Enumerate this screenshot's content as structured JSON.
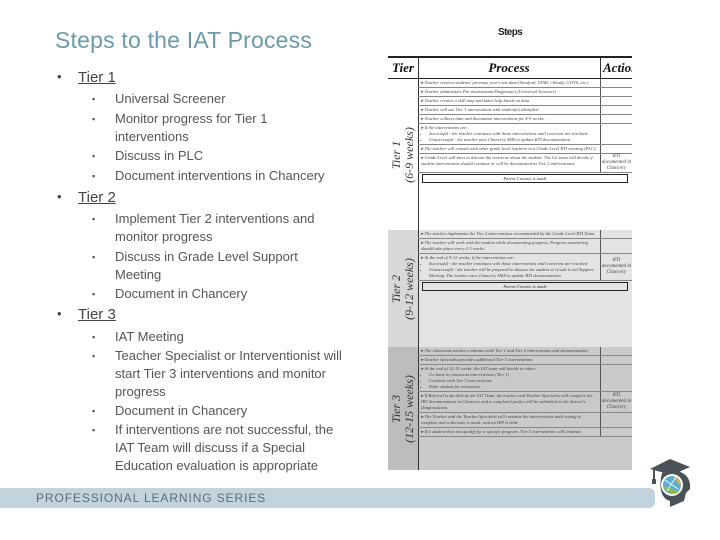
{
  "slide": {
    "title": "Steps to the IAT Process",
    "outline": [
      {
        "label": "Tier 1",
        "items": [
          "Universal Screener",
          "Monitor progress for Tier 1 interventions",
          "Discuss in PLC",
          "Document interventions in Chancery"
        ]
      },
      {
        "label": "Tier 2",
        "items": [
          "Implement Tier 2 interventions and monitor progress",
          "Discuss in Grade Level Support Meeting",
          "Document in Chancery"
        ]
      },
      {
        "label": "Tier 3",
        "items": [
          "IAT Meeting",
          "Teacher Specialist or Interventionist will start Tier 3 interventions and monitor progress",
          "Document in Chancery",
          "If interventions are not successful, the IAT Team will discuss if a Special Education evaluation is appropriate"
        ]
      }
    ],
    "footer": "PROFESSIONAL LEARNING SERIES",
    "logo_icon": "graduation-cap-head-globe-icon"
  },
  "document": {
    "title": "Steps",
    "headers": {
      "tier": "Tier",
      "process": "Process",
      "action": "Action"
    },
    "tiers": [
      {
        "label": "Tier 1",
        "duration": "(6-9 weeks)",
        "rows": [
          {
            "process": "Teacher reviews students' previous year's test data (Stanford, STAR, i-Ready, GOVS, etc.)",
            "action": ""
          },
          {
            "process": "Teacher administers Pre-assessments/Diagnostics (Universal Screener)",
            "action": ""
          },
          {
            "process": "Teacher creates a skill map and takes help based on data",
            "action": ""
          },
          {
            "process": "Teacher will use Tier 1 interventions with student(s) identified",
            "action": ""
          },
          {
            "process": "Teacher collects data and documents interventions for 4-9 weeks.",
            "action": ""
          },
          {
            "process": "If the interventions are:",
            "sub": [
              "Successful - the teacher continues with those interventions until concerns are resolved",
              "Unsuccessful - the teacher uses Chancery SMS to update RTI documentation"
            ],
            "action": ""
          },
          {
            "process": "The teacher will consult with other grade level teachers in a Grade Level RTI meeting (PLC).",
            "action": ""
          },
          {
            "process": "Grade Level will meet to discuss the concerns about the student. The GL team will decide if student interventions should continue or will be documented as Tier 2 interventions.",
            "action": "RTI documented in Chancery"
          }
        ],
        "contact": "Parent Contact is made"
      },
      {
        "label": "Tier 2",
        "duration": "(9-12 weeks)",
        "rows": [
          {
            "process": "The teacher implements the Tier 2 interventions recommended by the Grade Level RTI Team.",
            "action": ""
          },
          {
            "process": "The teacher will work with the student while documenting progress. Progress monitoring should take place every 2-3 weeks.",
            "action": ""
          },
          {
            "process": "At the end of 9-12 weeks, if the interventions are:",
            "sub": [
              "Successful - the teacher continues with those interventions until concerns are resolved",
              "Unsuccessful - the teacher will be prepared to discuss the student at Grade Level Support Meeting. The teacher uses Chancery SMS to update RTI documentation"
            ],
            "action": "RTI documented in Chancery"
          }
        ],
        "contact": "Parent Contact is made"
      },
      {
        "label": "Tier 3",
        "duration": "(12-15 weeks)",
        "rows": [
          {
            "process": "The classroom teacher continues with Tier 1 and Tier 2 interventions and documentation.",
            "action": ""
          },
          {
            "process": "Teacher Specialist provides additional Tier 3 interventions.",
            "action": ""
          },
          {
            "process": "At the end of 12-15 weeks, the IAT team will decide to either:",
            "sub": [
              "Go back to classroom interventions (Tier 1)",
              "Continue with Tier 3 interventions",
              "Refer student for evaluation"
            ],
            "action": ""
          },
          {
            "process": "If Referral is decided by the IAT Team, the teacher and Teacher Specialist will complete the IRT documentation in Chancery and a completed packet will be submitted to the district's Diagnostician.",
            "action": "RTI documented in Chancery"
          },
          {
            "process": "The Teacher and the Teacher Specialist will continue the interventions until testing is complete and a decision is made, and an IEP is held.",
            "action": ""
          },
          {
            "process": "If a student does not qualify for a specific program, Tier 3 interventions will continue.",
            "action": ""
          }
        ]
      }
    ]
  }
}
